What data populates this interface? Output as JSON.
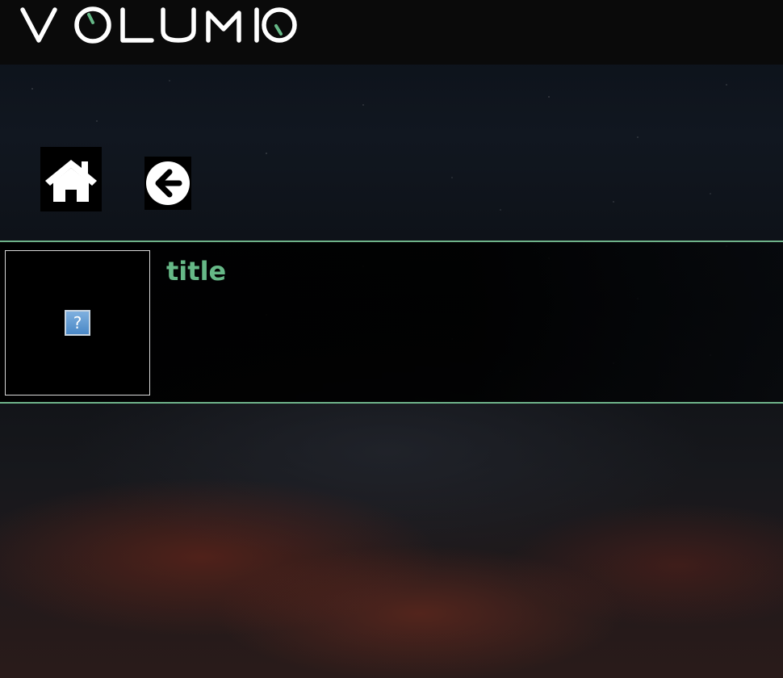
{
  "app": {
    "logo_text": "VOLUMIO",
    "accent_color": "#66b887",
    "logo_color": "#ffffff"
  },
  "nav": {
    "home_icon": "home-icon",
    "back_icon": "arrow-left-circle-icon"
  },
  "item": {
    "title": "title",
    "art_placeholder": "?"
  }
}
